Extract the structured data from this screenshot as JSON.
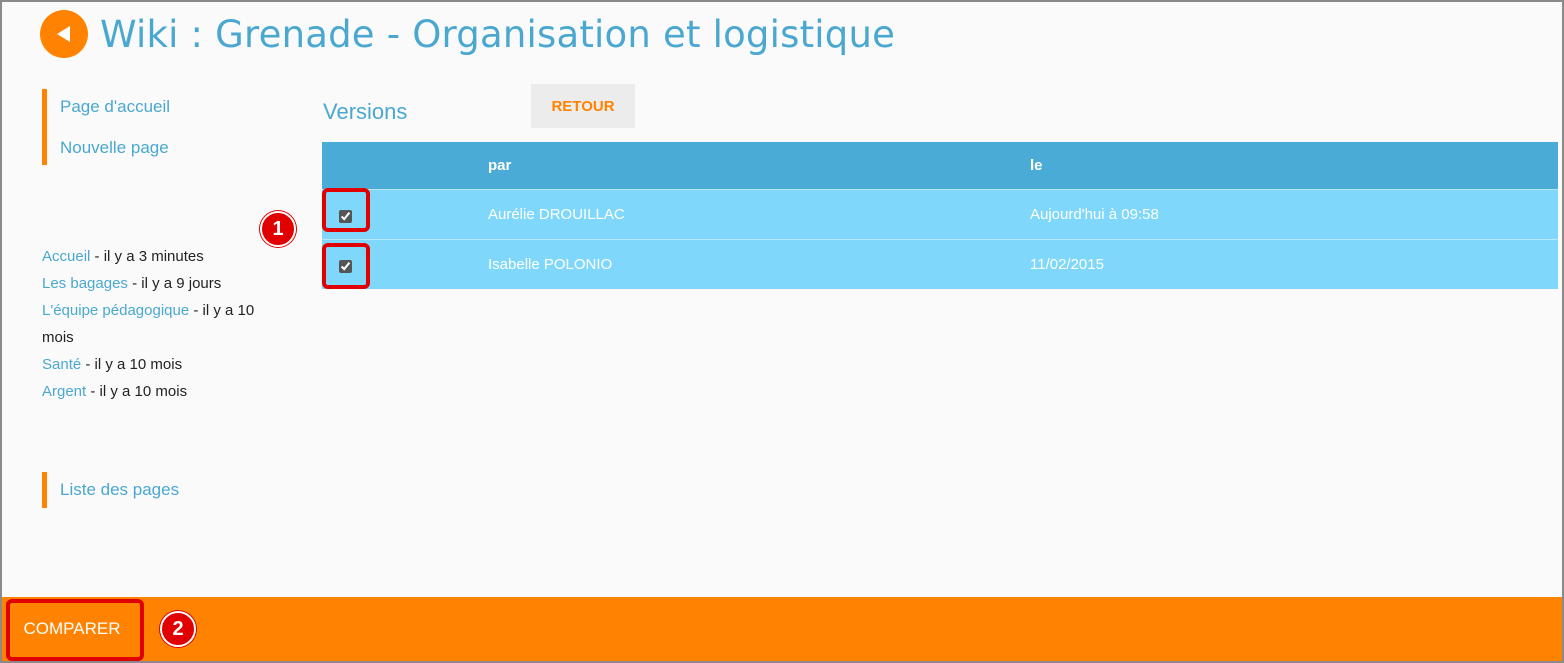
{
  "header": {
    "title": "Wiki : Grenade - Organisation et logistique"
  },
  "sidebar": {
    "top_links": [
      "Page d'accueil",
      "Nouvelle page"
    ],
    "recent": [
      {
        "link": "Accueil",
        "suffix": " - il y a 3 minutes"
      },
      {
        "link": "Les bagages",
        "suffix": " - il y a 9 jours"
      },
      {
        "link": "L'équipe pédagogique",
        "suffix": " - il y a 10 mois"
      },
      {
        "link": "Santé",
        "suffix": " - il y a 10 mois"
      },
      {
        "link": "Argent",
        "suffix": " - il y a 10 mois"
      }
    ],
    "bottom_link": "Liste des pages"
  },
  "main": {
    "section_title": "Versions",
    "back_button": "RETOUR",
    "table": {
      "columns": [
        "",
        "par",
        "le"
      ],
      "rows": [
        {
          "checked": true,
          "author": "Aurélie DROUILLAC",
          "date": "Aujourd'hui à 09:58"
        },
        {
          "checked": true,
          "author": "Isabelle POLONIO",
          "date": "11/02/2015"
        }
      ]
    }
  },
  "footer": {
    "compare_button": "COMPARER"
  },
  "annotations": [
    "1",
    "2"
  ],
  "colors": {
    "accent": "#ff8200",
    "link": "#4aa8d0",
    "table_header": "#4aabd6",
    "table_row": "#7fd8fc",
    "highlight": "#e00000"
  },
  "icons": {
    "back": "back-arrow-icon"
  }
}
